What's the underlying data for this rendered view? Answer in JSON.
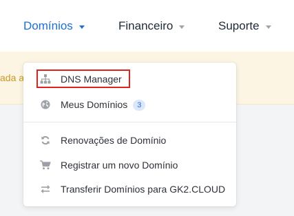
{
  "nav": {
    "items": [
      {
        "label": "Domínios",
        "active": true
      },
      {
        "label": "Financeiro",
        "active": false
      },
      {
        "label": "Suporte",
        "active": false
      }
    ]
  },
  "notice": {
    "text": "ada ac"
  },
  "dropdown": {
    "items": [
      {
        "label": "DNS Manager",
        "icon": "sitemap-icon"
      },
      {
        "label": "Meus Domínios",
        "icon": "globe-icon",
        "badge": "3"
      },
      {
        "label": "Renovações de Domínio",
        "icon": "sync-icon"
      },
      {
        "label": "Registrar um novo Domínio",
        "icon": "cart-icon"
      },
      {
        "label": "Transferir Domínios para GK2.CLOUD",
        "icon": "exchange-icon"
      }
    ]
  },
  "colors": {
    "accent": "#1d6fd8",
    "highlight": "#e0201c",
    "notice_bg": "#fdf5e3",
    "icon": "#9ca0a6"
  }
}
